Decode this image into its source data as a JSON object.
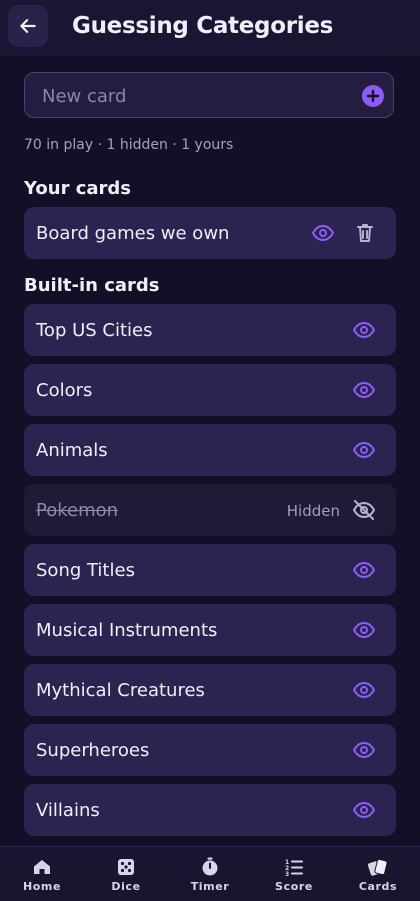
{
  "header": {
    "back_icon": "arrow-left-icon",
    "title": "Guessing Categories"
  },
  "new_card": {
    "placeholder": "New card",
    "add_icon": "plus-circle-icon"
  },
  "stats": "70 in play · 1 hidden · 1 yours",
  "your_cards": {
    "title": "Your cards",
    "items": [
      {
        "label": "Board games we own",
        "icons": [
          "eye-icon",
          "trash-icon"
        ]
      }
    ]
  },
  "builtin_cards": {
    "title": "Built-in cards",
    "items": [
      {
        "label": "Top US Cities",
        "hidden": false
      },
      {
        "label": "Colors",
        "hidden": false
      },
      {
        "label": "Animals",
        "hidden": false
      },
      {
        "label": "Pokemon",
        "hidden": true,
        "hidden_label": "Hidden"
      },
      {
        "label": "Song Titles",
        "hidden": false
      },
      {
        "label": "Musical Instruments",
        "hidden": false
      },
      {
        "label": "Mythical Creatures",
        "hidden": false
      },
      {
        "label": "Superheroes",
        "hidden": false
      },
      {
        "label": "Villains",
        "hidden": false
      }
    ]
  },
  "bottom_nav": [
    {
      "label": "Home",
      "icon": "home-icon"
    },
    {
      "label": "Dice",
      "icon": "dice-icon"
    },
    {
      "label": "Timer",
      "icon": "stopwatch-icon"
    },
    {
      "label": "Score",
      "icon": "list-numbered-icon"
    },
    {
      "label": "Cards",
      "icon": "cards-icon"
    }
  ],
  "colors": {
    "background": "#140f26",
    "accent": "#8b5cf6",
    "card": "#2c2450",
    "card_hidden": "#1f1a38"
  }
}
